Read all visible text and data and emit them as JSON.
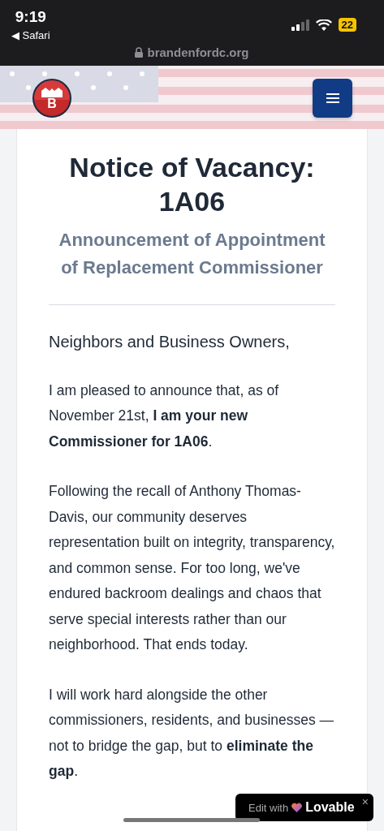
{
  "status_bar": {
    "time": "9:19",
    "back_app": "◀ Safari",
    "battery": "22",
    "url": "brandenfordc.org"
  },
  "header": {
    "logo_letter": "B"
  },
  "notice": {
    "title": "Notice of Vacancy: 1A06",
    "subtitle": "Announcement of Appointment of Replacement Commissioner",
    "greeting": "Neighbors and Business Owners,",
    "paragraphs": [
      "I am pleased to announce that, as of November 21st, **I am your new Commissioner for 1A06**.",
      "Following the recall of Anthony Thomas-Davis, our community deserves representation built on integrity, transparency, and common sense. For too long, we've endured backroom dealings and chaos that serve special interests rather than our neighborhood. That ends today.",
      "I will work hard alongside the other commissioners, residents, and businesses — not to bridge the gap, but to **eliminate the gap**."
    ]
  },
  "badge": {
    "prefix": "Edit with",
    "brand": "Lovable",
    "close": "×"
  }
}
